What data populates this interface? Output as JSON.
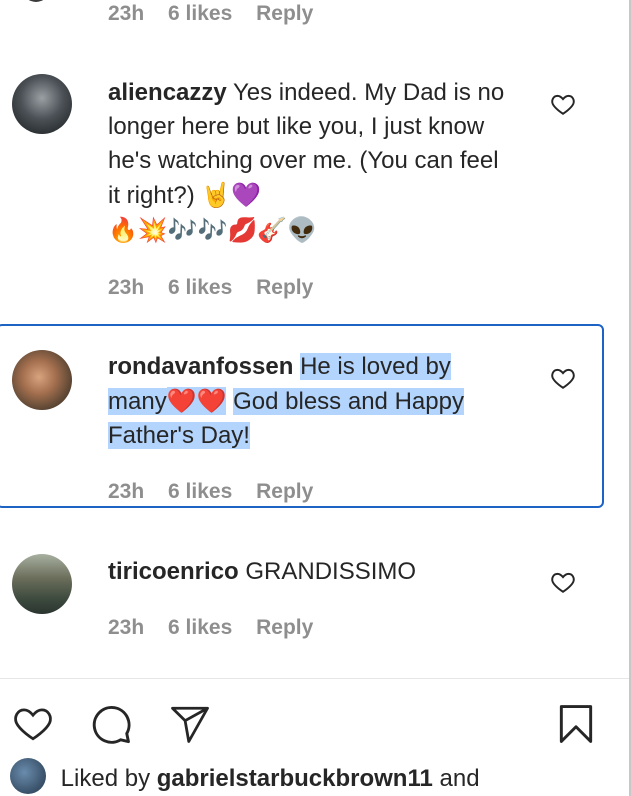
{
  "comments": [
    {
      "meta": {
        "time": "23h",
        "likes": "6 likes",
        "reply": "Reply"
      }
    },
    {
      "username": "aliencazzy",
      "text": "Yes indeed. My Dad is no longer here but like you, I just know he's watching over me. (You can feel it right?)",
      "emoji_line1": "🤘💜",
      "emoji_line2": "🔥💥🎶🎶💋🎸👽",
      "meta": {
        "time": "23h",
        "likes": "6 likes",
        "reply": "Reply"
      }
    },
    {
      "username": "rondavanfossen",
      "text_part1": "He is loved by many",
      "emoji": "❤️❤️",
      "text_part2": "God bless and Happy Father's Day!",
      "meta": {
        "time": "23h",
        "likes": "6 likes",
        "reply": "Reply"
      }
    },
    {
      "username": "tiricoenrico",
      "text": "GRANDISSIMO",
      "meta": {
        "time": "23h",
        "likes": "6 likes",
        "reply": "Reply"
      }
    }
  ],
  "liked_by": {
    "prefix": "Liked by",
    "user": "gabrielstarbuckbrown11",
    "suffix": "and"
  },
  "icons": [
    "heart-icon",
    "comment-icon",
    "share-icon",
    "bookmark-icon"
  ],
  "colors": {
    "selection": "#b3d4fc",
    "focus_border": "#1d63c4",
    "meta_gray": "#8e8e8e"
  }
}
